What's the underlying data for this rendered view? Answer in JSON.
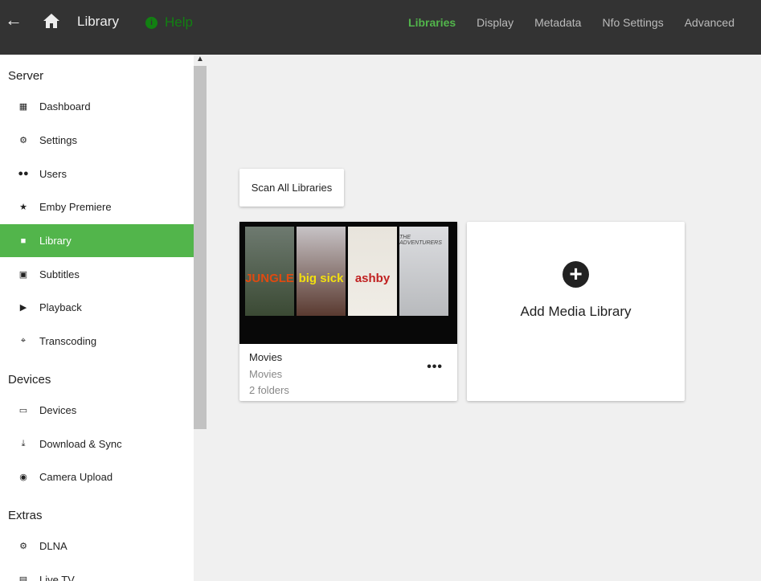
{
  "header": {
    "title": "Library",
    "help": "Help",
    "tabs": [
      {
        "label": "Libraries",
        "active": true
      },
      {
        "label": "Display"
      },
      {
        "label": "Metadata"
      },
      {
        "label": "Nfo Settings"
      },
      {
        "label": "Advanced"
      }
    ]
  },
  "sidebar": {
    "server": "Server",
    "server_items": [
      "Dashboard",
      "Settings",
      "Users",
      "Emby Premiere",
      "Library",
      "Subtitles",
      "Playback",
      "Transcoding"
    ],
    "devices": "Devices",
    "devices_items": [
      "Devices",
      "Download & Sync",
      "Camera Upload"
    ],
    "extras": "Extras",
    "extras_items": [
      "DLNA",
      "Live TV"
    ]
  },
  "main": {
    "scan_button": "Scan All Libraries",
    "library": {
      "name": "Movies",
      "type": "Movies",
      "folders": "2 folders",
      "more": "•••",
      "posters": [
        "JUNGLE",
        "big sick",
        "ashby",
        "THE ADVENTURERS"
      ]
    },
    "add_library": "Add Media Library",
    "add_icon": "+"
  }
}
